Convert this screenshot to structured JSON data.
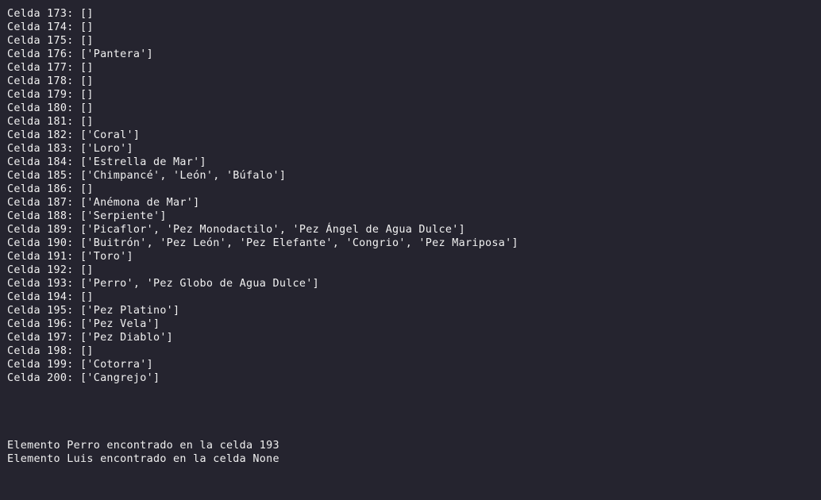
{
  "output_lines": [
    "Celda 173: []",
    "Celda 174: []",
    "Celda 175: []",
    "Celda 176: ['Pantera']",
    "Celda 177: []",
    "Celda 178: []",
    "Celda 179: []",
    "Celda 180: []",
    "Celda 181: []",
    "Celda 182: ['Coral']",
    "Celda 183: ['Loro']",
    "Celda 184: ['Estrella de Mar']",
    "Celda 185: ['Chimpancé', 'León', 'Búfalo']",
    "Celda 186: []",
    "Celda 187: ['Anémona de Mar']",
    "Celda 188: ['Serpiente']",
    "Celda 189: ['Picaflor', 'Pez Monodactilo', 'Pez Ángel de Agua Dulce']",
    "Celda 190: ['Buitrón', 'Pez León', 'Pez Elefante', 'Congrio', 'Pez Mariposa']",
    "Celda 191: ['Toro']",
    "Celda 192: []",
    "Celda 193: ['Perro', 'Pez Globo de Agua Dulce']",
    "Celda 194: []",
    "Celda 195: ['Pez Platino']",
    "Celda 196: ['Pez Vela']",
    "Celda 197: ['Pez Diablo']",
    "Celda 198: []",
    "Celda 199: ['Cotorra']",
    "Celda 200: ['Cangrejo']"
  ],
  "search_results": [
    "Elemento Perro encontrado en la celda 193",
    "Elemento Luis encontrado en la celda None"
  ],
  "colors": {
    "background": "#25242f",
    "text": "#f1f1f1"
  }
}
